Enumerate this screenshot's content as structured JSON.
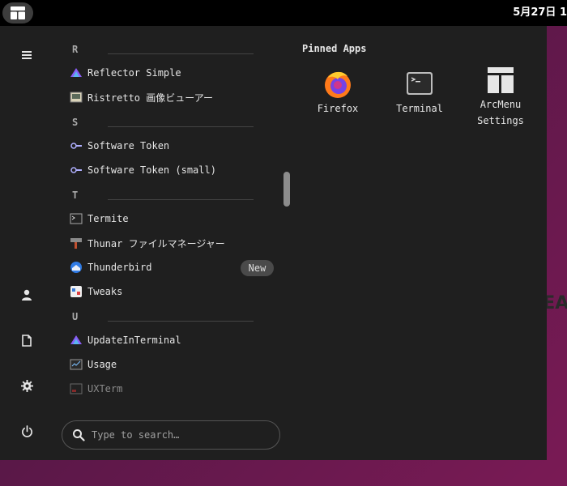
{
  "topbar": {
    "clock": "5月27日 1"
  },
  "background": {
    "logo_text": "DEA"
  },
  "sidebar": {
    "buttons": [
      {
        "name": "hamburger-menu-icon"
      },
      {
        "name": "user-icon"
      },
      {
        "name": "document-icon"
      },
      {
        "name": "gear-icon"
      },
      {
        "name": "power-icon"
      }
    ]
  },
  "app_list": {
    "sections": [
      {
        "letter": "R"
      },
      {
        "letter": "S"
      },
      {
        "letter": "T"
      },
      {
        "letter": "U"
      }
    ],
    "items": [
      {
        "label": "Reflector Simple",
        "icon": "reflector-icon"
      },
      {
        "label": "Ristretto 画像ビューアー",
        "icon": "image-viewer-icon"
      },
      {
        "label": "Software Token",
        "icon": "key-icon"
      },
      {
        "label": "Software Token (small)",
        "icon": "key-icon"
      },
      {
        "label": "Termite",
        "icon": "terminal-icon"
      },
      {
        "label": "Thunar ファイルマネージャー",
        "icon": "file-manager-icon"
      },
      {
        "label": "Thunderbird",
        "icon": "thunderbird-icon",
        "badge": "New"
      },
      {
        "label": "Tweaks",
        "icon": "tweaks-icon"
      },
      {
        "label": "UpdateInTerminal",
        "icon": "update-icon"
      },
      {
        "label": "Usage",
        "icon": "usage-icon"
      },
      {
        "label": "UXTerm",
        "icon": "uxterm-icon"
      }
    ]
  },
  "search": {
    "placeholder": "Type to search…"
  },
  "pinned": {
    "title": "Pinned Apps",
    "apps": [
      {
        "label": "Firefox",
        "icon": "firefox-icon"
      },
      {
        "label": "Terminal",
        "icon": "terminal-icon"
      },
      {
        "label_line1": "ArcMenu",
        "label_line2": "Settings",
        "icon": "arcmenu-settings-icon"
      }
    ]
  },
  "colors": {
    "menu_bg": "#1f1f1f",
    "topbar_bg": "#000000",
    "accent_purple": "#8a5cf6",
    "desktop_magenta": "#7a1a55"
  }
}
